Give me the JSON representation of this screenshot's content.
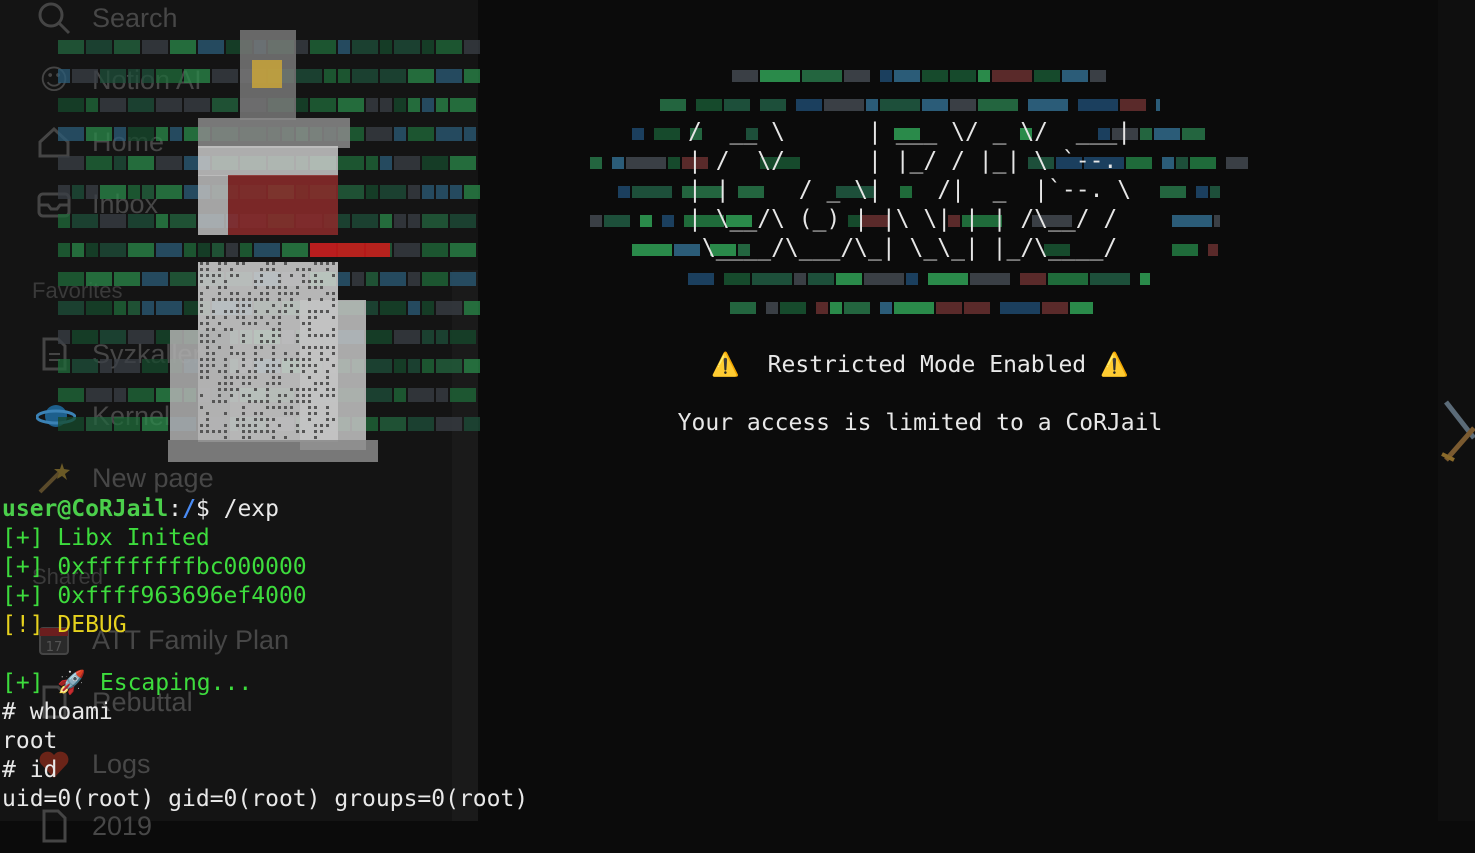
{
  "sidebar": {
    "search_label": "Search",
    "items": [
      {
        "label": "Notion AI",
        "icon": "notion-ai-icon"
      },
      {
        "label": "Home",
        "icon": "home-icon"
      },
      {
        "label": "Inbox",
        "icon": "inbox-icon"
      }
    ],
    "favorites_label": "Favorites",
    "favorites": [
      {
        "label": "Syzkaller",
        "icon": "page-icon"
      },
      {
        "label": "Kernel",
        "icon": "planet-icon"
      },
      {
        "label": "New page",
        "icon": "magic-wand-icon"
      }
    ],
    "shared_label": "Shared",
    "shared": [
      {
        "label": "ATT Family Plan",
        "icon": "calendar-icon"
      },
      {
        "label": "Rebuttal",
        "icon": "page-icon"
      },
      {
        "label": "Logs",
        "icon": "heart-icon"
      },
      {
        "label": "2019",
        "icon": "page-icon"
      }
    ]
  },
  "banner": {
    "ascii": [
      "/  __ \\      | ___ \\/ _ \\/  ___|",
      "| /  \\/      | |_/ / |_| \\ `--.",
      "| |     / _ \\|    /|  _  |`--. \\",
      "| \\__/\\ (_) | |\\ \\| | | /\\__/ /",
      " \\____/\\___/\\_| \\_\\_| |_/\\____/"
    ],
    "warning_icon": "⚠️",
    "restricted_text": "Restricted Mode Enabled",
    "access_text": "Your access is limited to a CoRJail"
  },
  "terminal": {
    "prompt_user": "user@CoRJail",
    "prompt_sep": ":",
    "prompt_path": "/",
    "prompt_symbol": "$",
    "command": " /exp",
    "lines": [
      "[+] Libx Inited",
      "[+] 0xffffffffbc000000",
      "[+] 0xffff963696ef4000",
      "[!] DEBUG",
      "",
      "[+] 🚀 Escaping...",
      "# whoami",
      "root",
      "# id",
      "uid=0(root) gid=0(root) groups=0(root)"
    ]
  },
  "colors": {
    "green": "#3ddc3d",
    "yellow": "#e6d21e",
    "prompt_path": "#4a8cf5",
    "warning": "#f2c21b"
  }
}
